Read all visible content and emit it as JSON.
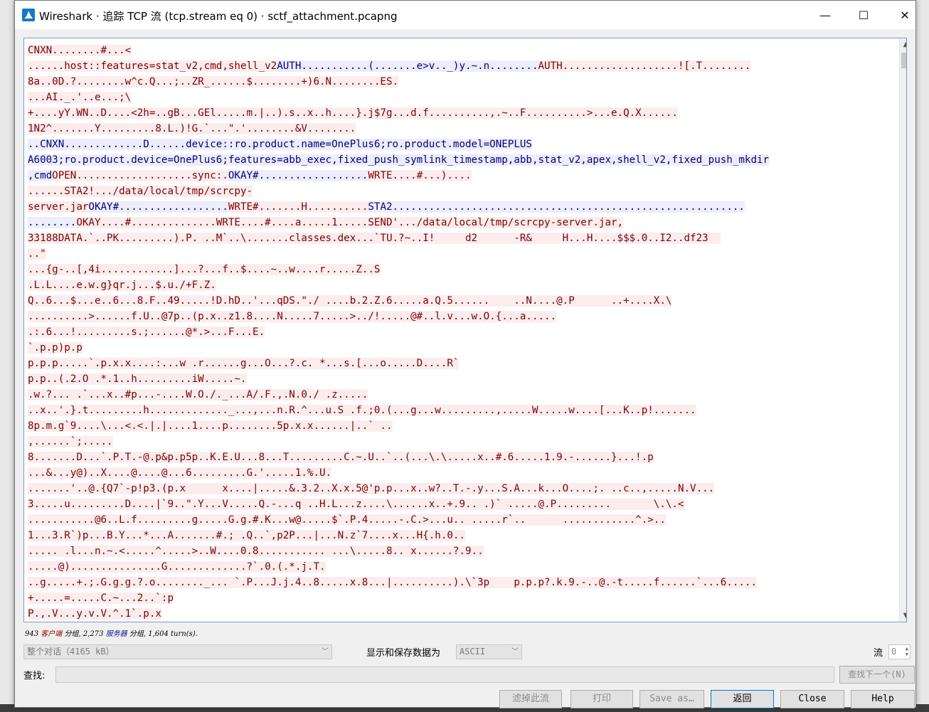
{
  "window": {
    "title": "Wireshark · 追踪 TCP 流 (tcp.stream eq 0) · sctf_attachment.pcapng",
    "minimize": "—",
    "maximize": "☐",
    "close": "✕"
  },
  "stream_lines": [
    [
      {
        "t": "CNXN........#...<",
        "k": "c"
      }
    ],
    [
      {
        "t": "......host::features=stat_v2,cmd,shell_v2",
        "k": "c"
      },
      {
        "t": "AUTH...........(.......e>v.._)y.~.n........",
        "k": "s"
      },
      {
        "t": "AUTH...................![.T........",
        "k": "c"
      }
    ],
    [
      {
        "t": "8a..0D.?........w^c.Q...;..ZR_......$........+)6.N........ES.",
        "k": "c"
      }
    ],
    [
      {
        "t": "...AI._.'..e...;\\",
        "k": "c"
      }
    ],
    [
      {
        "t": "+....yY.WN..D....<2h=..gB...GEl.....m.|..).s..x..h....}.j$7g...d.f..........,.~..F..........>...e.Q.X......",
        "k": "c"
      }
    ],
    [
      {
        "t": "1N2^.......Y.........8.L.)!G.`...\".'........&V........",
        "k": "c"
      }
    ],
    [
      {
        "t": "..CNXN.............D......device::ro.product.name=OnePlus6;ro.product.model=ONEPLUS",
        "k": "s"
      }
    ],
    [
      {
        "t": "A6003;ro.product.device=OnePlus6;features=abb_exec,fixed_push_symlink_timestamp,abb,stat_v2,apex,shell_v2,fixed_push_mkdir",
        "k": "s"
      }
    ],
    [
      {
        "t": ",cmd",
        "k": "s"
      },
      {
        "t": "OPEN...................sync:.",
        "k": "c"
      },
      {
        "t": "OKAY#..................",
        "k": "s"
      },
      {
        "t": "WRTE....#...)....",
        "k": "c"
      }
    ],
    [
      {
        "t": "......STA2!.../data/local/tmp/scrcpy-",
        "k": "c"
      }
    ],
    [
      {
        "t": "server.jar",
        "k": "c"
      },
      {
        "t": "OKAY#..................",
        "k": "s"
      },
      {
        "t": "WRTE#.......H..........",
        "k": "c"
      },
      {
        "t": "STA2..........................................................",
        "k": "s"
      }
    ],
    [
      {
        "t": "........",
        "k": "s"
      },
      {
        "t": "OKAY....#..............",
        "k": "c"
      },
      {
        "t": "WRTE....#....a.....1.....SEND'.../data/local/tmp/scrcpy-server.jar,",
        "k": "c"
      }
    ],
    [
      {
        "t": "33188DATA.`..PK.........).P. ..M`..\\.......classes.dex...`TU.?~..I!     d2      -R&     H...H....$$$.0..I2..df23  ",
        "k": "c"
      }
    ],
    [
      {
        "t": "..\"",
        "k": "c"
      }
    ],
    [
      {
        "t": "...{g-..[,4i............]...?...f..$....~..w....r.....Z..S",
        "k": "c"
      }
    ],
    [
      {
        "t": ".L.L....e.w.g}qr.j...$.u./+F.Z.",
        "k": "c"
      }
    ],
    [
      {
        "t": "Q..6...$...e..6...8.F..49.....!D.hD..'...qDS.\"./ ....b.2.Z.6.....a.Q.5......    ..N....@.P      ..+....X.\\",
        "k": "c"
      }
    ],
    [
      {
        "t": "..........>......f.U..@7p..(p.x..z1.8....N.....7.....>../!.....@#..l.v...w.O.{...a.....",
        "k": "c"
      }
    ],
    [
      {
        "t": ".:.6...!.........s.;......@*.>...F...E.",
        "k": "c"
      }
    ],
    [
      {
        "t": "`.p.p)p.p",
        "k": "c"
      }
    ],
    [
      {
        "t": "p.p.p.....`.p.x.x....:...w .r......g...O...?.c. *...s.[...o.....D....R`",
        "k": "c"
      }
    ],
    [
      {
        "t": "p.p..(.2.O .*.1..h.........iW.....~.",
        "k": "c"
      }
    ],
    [
      {
        "t": ".w.?... .`...x..#p...-....W.O./._...A/.F.,.N.0./ .z.....",
        "k": "c"
      }
    ],
    [
      {
        "t": "..x..'.}.t.........h............._...,...n.R.^...u.S .f.;0.(...g...w.........,.....W.....w....[...K..p!.......",
        "k": "c"
      }
    ],
    [
      {
        "t": "8p.m.g`9....\\...<.<.|.|....1....p........5p.x.x......|..` ..",
        "k": "c"
      }
    ],
    [
      {
        "t": ",......`;.....",
        "k": "c"
      }
    ],
    [
      {
        "t": "8.......D...`.P.T.-@.p&p.p5p..K.E.U...8...T.........C.~.U..`..(...\\.\\.....x..#.6.....1.9.-......}...!.p",
        "k": "c"
      }
    ],
    [
      {
        "t": "...&...y@)..X....@....@...6.........G.'.....1.%.U.",
        "k": "c"
      }
    ],
    [
      {
        "t": ".......'..@.{Q7`-p!p3.(p.x      x....|.....&.3.2..X.x.5@'p.p...x..w?..T.-.y...S.A...k...O....;. ..c..,.....N.V...",
        "k": "c"
      }
    ],
    [
      {
        "t": "3.....u.........D....|`9..\".Y...V.....Q.-...q ..H.L...z....\\......x..+.9.. .)` .....@.P.........       \\.\\.<",
        "k": "c"
      }
    ],
    [
      {
        "t": "...........@6..L.f.........g.....G.g.#.K...w@.....$`.P.4.....-.C.>...u.. .....r`..      ............^.>..",
        "k": "c"
      }
    ],
    [
      {
        "t": "1...3.R`)p...B.Y...*...A.......#.; .Q..`,p2P...|...N.z`7....x...H{.h.0..",
        "k": "c"
      }
    ],
    [
      {
        "t": "..... .l...n.~.<.....^.....>..W....0.8........... ...\\.....8.. x......?.9..",
        "k": "c"
      }
    ],
    [
      {
        "t": ".....@)...............G.............?`.0.(.*.j.T.",
        "k": "c"
      }
    ],
    [
      {
        "t": "..g.....+.;.G.g.g.?.o........_... `.P...J.j.4..8.....x.8...|..........).\\`3p    p.p.p?.k.9.-..@.-t.....f......`...6.....",
        "k": "c"
      }
    ],
    [
      {
        "t": "+.....=.....C.~...2..`:p",
        "k": "c"
      }
    ],
    [
      {
        "t": "P.,.V...y.v.V.^.1`.p.x",
        "k": "c"
      }
    ]
  ],
  "summary": {
    "client_count": "943",
    "client_label": "客户端",
    "packets1": "分组,",
    "server_count": "2,273",
    "server_label": "服务器",
    "packets2": "分组,",
    "turns": "1,604 turn(s)."
  },
  "controls": {
    "conversation": "整个对话（4165 kB）",
    "show_as_label": "显示和保存数据为",
    "format": "ASCII",
    "stream_label": "流",
    "stream_value": "0",
    "find_label": "查找:",
    "find_value": "",
    "find_next": "查找下一个(N)"
  },
  "buttons": {
    "filter_out": "滤掉此流",
    "print": "打印",
    "save_as": "Save as…",
    "back": "返回",
    "close": "Close",
    "help": "Help"
  },
  "colors": {
    "client_bg": "#fbeded",
    "client_fg": "#7f0000",
    "server_bg": "#ededfb",
    "server_fg": "#00007f"
  }
}
